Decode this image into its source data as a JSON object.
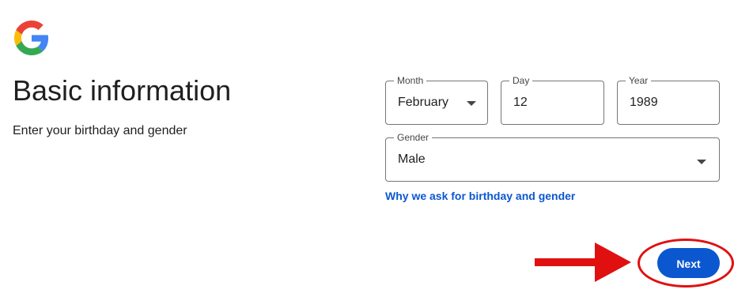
{
  "logo": {
    "icon": "google-g-logo-icon",
    "colors": [
      "#4285F4",
      "#EA4335",
      "#FBBC05",
      "#34A853"
    ]
  },
  "header": {
    "title": "Basic information",
    "subtitle": "Enter your birthday and gender"
  },
  "form": {
    "month": {
      "label": "Month",
      "value": "February"
    },
    "day": {
      "label": "Day",
      "value": "12"
    },
    "year": {
      "label": "Year",
      "value": "1989"
    },
    "gender": {
      "label": "Gender",
      "value": "Male"
    },
    "why_link": "Why we ask for birthday and gender"
  },
  "actions": {
    "next_label": "Next",
    "accent": "#0b57d0"
  },
  "annotation": {
    "color": "#e01010",
    "arrow_icon": "arrow-right-icon"
  }
}
